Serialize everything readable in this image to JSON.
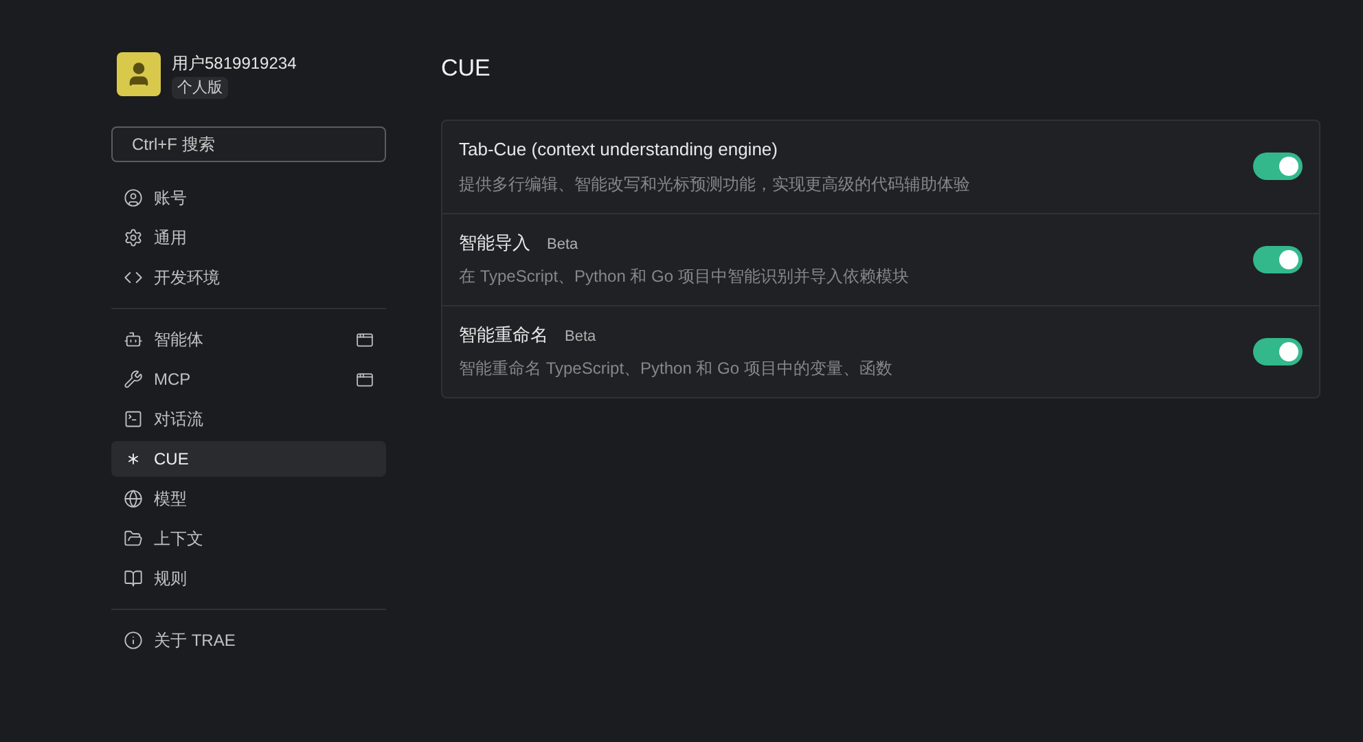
{
  "user": {
    "name": "用户5819919234",
    "plan": "个人版"
  },
  "search": {
    "placeholder": "Ctrl+F 搜索"
  },
  "sidebar": {
    "groups": [
      [
        {
          "label": "账号",
          "selected": false,
          "popout": false
        },
        {
          "label": "通用",
          "selected": false,
          "popout": false
        },
        {
          "label": "开发环境",
          "selected": false,
          "popout": false
        }
      ],
      [
        {
          "label": "智能体",
          "selected": false,
          "popout": true
        },
        {
          "label": "MCP",
          "selected": false,
          "popout": true
        },
        {
          "label": "对话流",
          "selected": false,
          "popout": false
        },
        {
          "label": "CUE",
          "selected": true,
          "popout": false
        },
        {
          "label": "模型",
          "selected": false,
          "popout": false
        },
        {
          "label": "上下文",
          "selected": false,
          "popout": false
        },
        {
          "label": "规则",
          "selected": false,
          "popout": false
        }
      ],
      [
        {
          "label": "关于 TRAE",
          "selected": false,
          "popout": false
        }
      ]
    ]
  },
  "page": {
    "title": "CUE",
    "settings": [
      {
        "title": "Tab-Cue (context understanding engine)",
        "description": "提供多行编辑、智能改写和光标预测功能，实现更高级的代码辅助体验",
        "on": true
      },
      {
        "title": "智能导入",
        "badge": "Beta",
        "description": "在 TypeScript、Python 和 Go 项目中智能识别并导入依赖模块",
        "on": true
      },
      {
        "title": "智能重命名",
        "badge": "Beta",
        "description": "智能重命名 TypeScript、Python 和 Go 项目中的变量、函数",
        "on": true
      }
    ]
  }
}
